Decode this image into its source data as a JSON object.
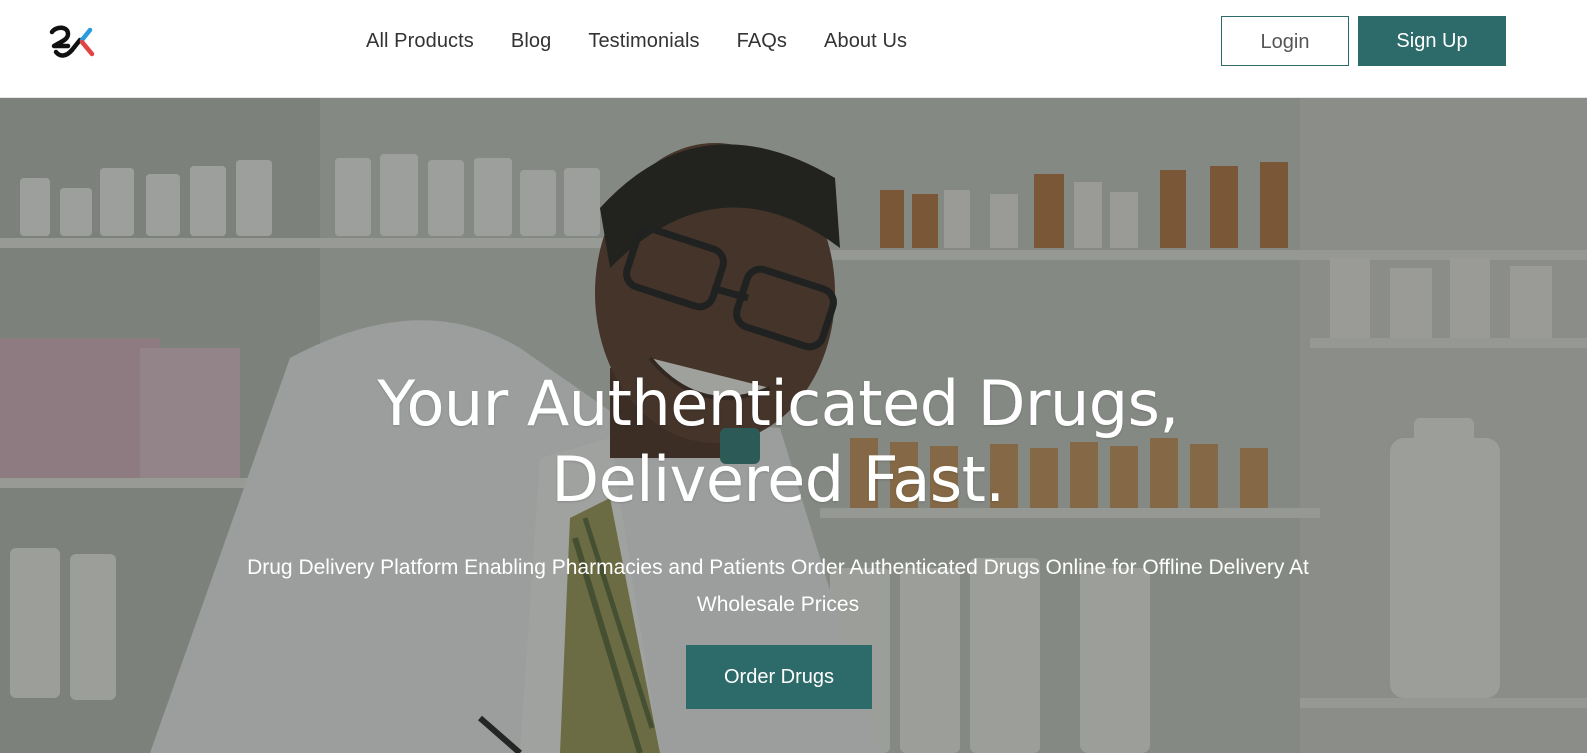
{
  "brand": {
    "logo_icon": "rx-logo-icon",
    "accent_color": "#2d6b6a"
  },
  "nav": {
    "links": [
      {
        "label": "All Products"
      },
      {
        "label": "Blog"
      },
      {
        "label": "Testimonials"
      },
      {
        "label": "FAQs"
      },
      {
        "label": "About Us"
      }
    ],
    "login_label": "Login",
    "signup_label": "Sign Up"
  },
  "hero": {
    "title_line1": "Your Authenticated Drugs,",
    "title_line2": "Delivered Fast.",
    "subtitle": "Drug Delivery Platform Enabling Pharmacies and Patients Order Authenticated Drugs Online for Offline Delivery At Wholesale Prices",
    "cta_label": "Order Drugs",
    "background_icon": "pharmacist-photo"
  }
}
